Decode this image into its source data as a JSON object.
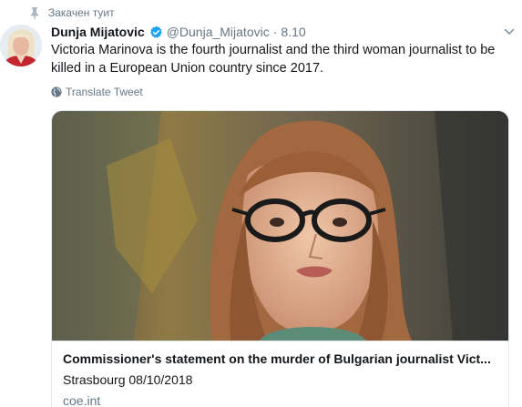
{
  "pinned": {
    "label": "Закачен туит",
    "icon": "pin-icon"
  },
  "author": {
    "name": "Dunja Mijatovic",
    "verified_icon": "verified-badge-icon",
    "handle": "@Dunja_Mijatovic",
    "separator": "·",
    "date": "8.10"
  },
  "tweet": {
    "text": "Victoria Marinova is the fourth journalist and the third woman journalist to be killed in a European Union country since 2017."
  },
  "translate": {
    "label": "Translate Tweet",
    "icon": "globe-icon"
  },
  "card": {
    "title": "Commissioner's statement on the murder of Bulgarian journalist Vict...",
    "description": "Strasbourg 08/10/2018",
    "domain": "coe.int"
  },
  "colors": {
    "accent": "#1da1f2",
    "secondary_text": "#657786",
    "border": "#e1e8ed"
  }
}
